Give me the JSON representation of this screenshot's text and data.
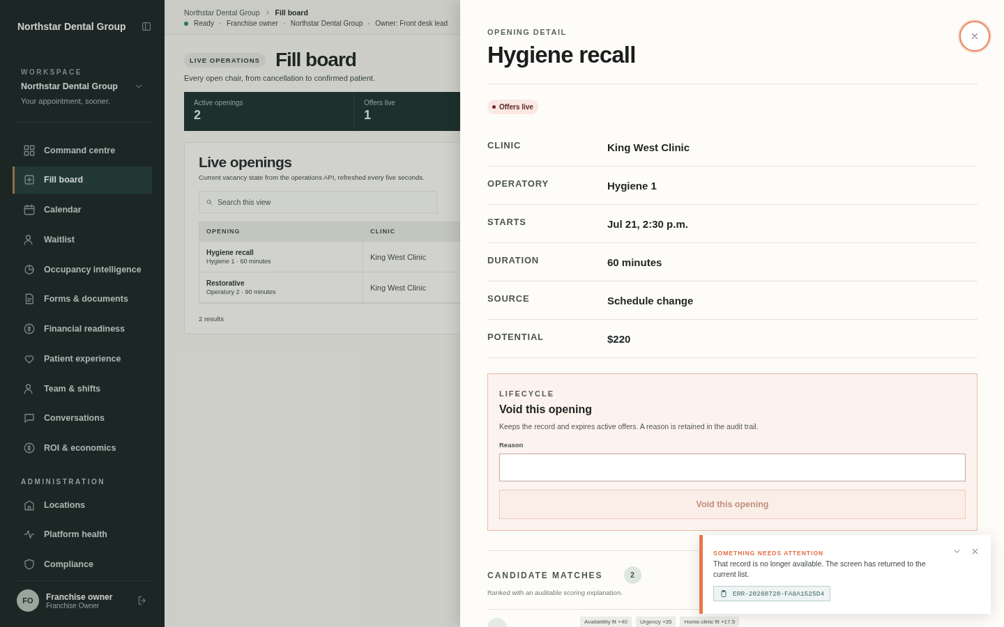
{
  "sidebar": {
    "brand": "Northstar Dental Group",
    "workspace_label": "WORKSPACE",
    "workspace_name": "Northstar Dental Group",
    "workspace_tagline": "Your appointment, sooner.",
    "sections": [
      {
        "items": [
          {
            "label": "Command centre",
            "selected": false
          },
          {
            "label": "Fill board",
            "selected": true
          },
          {
            "label": "Calendar",
            "selected": false
          },
          {
            "label": "Waitlist",
            "selected": false
          },
          {
            "label": "Occupancy intelligence",
            "selected": false
          },
          {
            "label": "Forms & documents",
            "selected": false
          },
          {
            "label": "Financial readiness",
            "selected": false
          },
          {
            "label": "Patient experience",
            "selected": false
          },
          {
            "label": "Team & shifts",
            "selected": false
          },
          {
            "label": "Conversations",
            "selected": false
          },
          {
            "label": "ROI & economics",
            "selected": false
          }
        ]
      },
      {
        "heading": "ADMINISTRATION",
        "items": [
          {
            "label": "Locations",
            "selected": false
          },
          {
            "label": "Platform health",
            "selected": false
          },
          {
            "label": "Compliance",
            "selected": false
          }
        ]
      }
    ],
    "user": {
      "initials": "FO",
      "name": "Franchise owner",
      "role": "Franchise Owner"
    }
  },
  "main": {
    "breadcrumb": [
      "Northstar Dental Group",
      "Fill board"
    ],
    "status": "Ready",
    "context": [
      "Franchise owner",
      "Northstar Dental Group",
      "Owner: Front desk lead"
    ],
    "eyebrow": "LIVE OPERATIONS",
    "title": "Fill board",
    "subtitle": "Every open chair, from cancellation to confirmed patient.",
    "stats": [
      {
        "label": "Active openings",
        "value": "2"
      },
      {
        "label": "Offers live",
        "value": "1"
      }
    ],
    "panel": {
      "title": "Live openings",
      "subtitle": "Current vacancy state from the operations API, refreshed every five seconds.",
      "search_placeholder": "Search this view",
      "columns": [
        "OPENING",
        "CLINIC"
      ],
      "rows": [
        {
          "title": "Hygiene recall",
          "detail": "Hygiene 1 · 60 minutes",
          "clinic": "King West Clinic"
        },
        {
          "title": "Restorative",
          "detail": "Operatory 2 · 90 minutes",
          "clinic": "King West Clinic"
        }
      ],
      "results": "2 results"
    }
  },
  "drawer": {
    "eyebrow": "OPENING DETAIL",
    "title": "Hygiene recall",
    "badge": "Offers live",
    "details": [
      {
        "label": "CLINIC",
        "value": "King West Clinic"
      },
      {
        "label": "OPERATORY",
        "value": "Hygiene 1"
      },
      {
        "label": "STARTS",
        "value": "Jul 21, 2:30 p.m."
      },
      {
        "label": "DURATION",
        "value": "60 minutes"
      },
      {
        "label": "SOURCE",
        "value": "Schedule change"
      },
      {
        "label": "POTENTIAL",
        "value": "$220"
      }
    ],
    "lifecycle": {
      "eyebrow": "LIFECYCLE",
      "title": "Void this opening",
      "description": "Keeps the record and expires active offers. A reason is retained in the audit trail.",
      "reason_label": "Reason",
      "button": "Void this opening",
      "button_disabled": true
    },
    "candidates": {
      "heading": "CANDIDATE MATCHES",
      "count": "2",
      "subtitle": "Ranked with an auditable scoring explanation.",
      "chips": [
        "Availability fit +40",
        "Urgency +35",
        "Home-clinic fit +17.5"
      ]
    }
  },
  "toast": {
    "title": "SOMETHING NEEDS ATTENTION",
    "message": "That record is no longer available. The screen has returned to the current list.",
    "code": "ERR-20260720-FA8A1525D4"
  }
}
